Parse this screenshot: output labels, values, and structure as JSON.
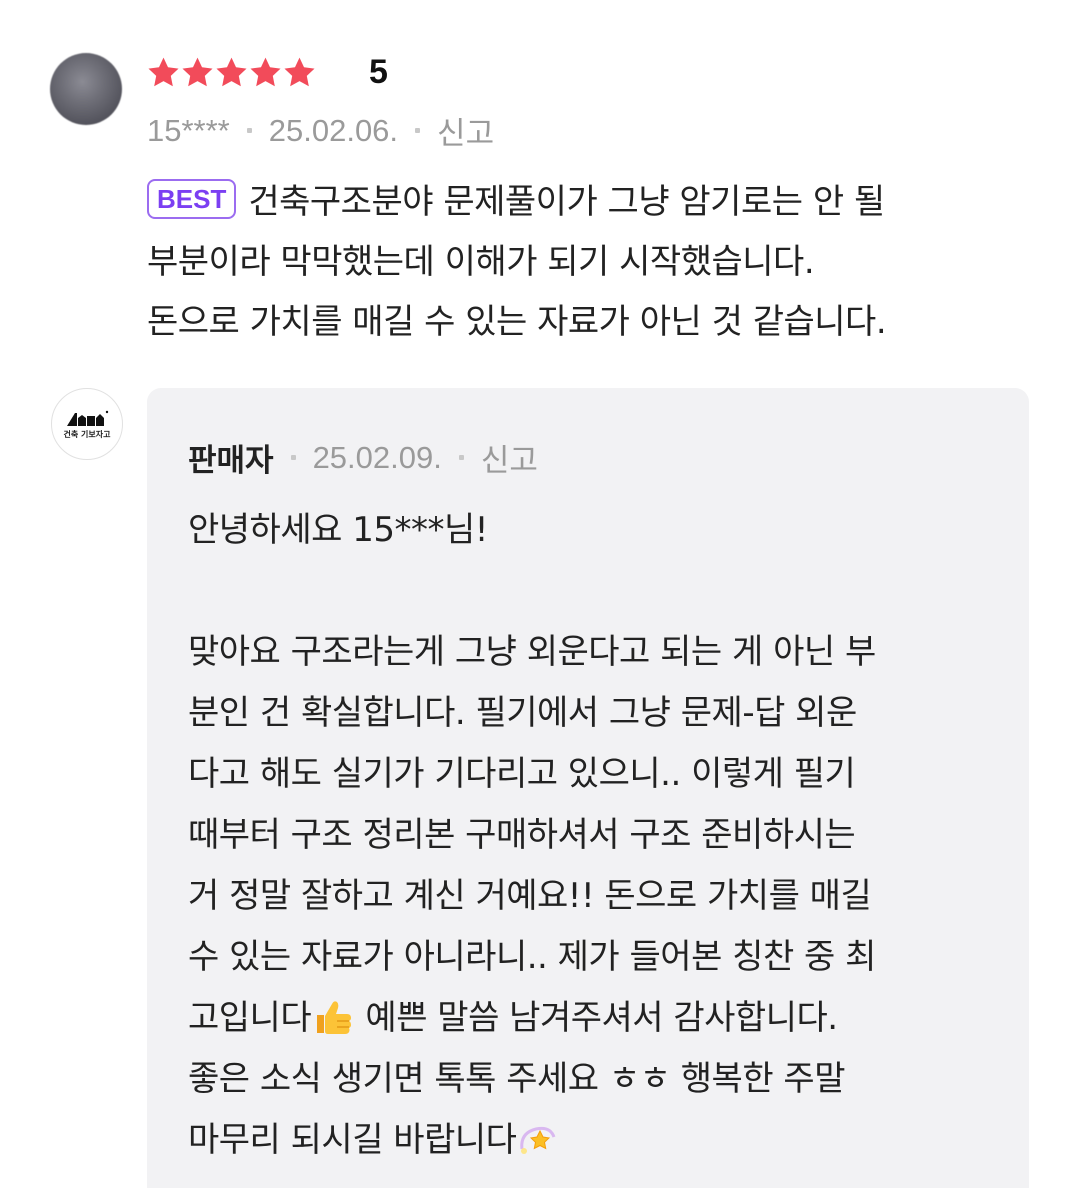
{
  "review": {
    "rating": "5",
    "stars_count": 5,
    "star_color": "#f24b5a",
    "user": "15****",
    "date": "25.02.06.",
    "report_label": "신고",
    "badge": "BEST",
    "badge_color": "#7b3ff2",
    "text_lines": [
      "건축구조분야 문제풀이가 그냥 암기로는 안 될",
      "부분이라 막막했는데 이해가 되기 시작했습니다.",
      "돈으로 가치를 매길 수 있는 자료가 아닌 것 같습니다."
    ]
  },
  "reply": {
    "seller_label": "판매자",
    "date": "25.02.09.",
    "report_label": "신고",
    "logo_text": "건축 기보자고",
    "greeting": "안녕하세요 15***님!",
    "lines": [
      "맞아요 구조라는게 그냥 외운다고 되는 게 아닌 부",
      "분인 건 확실합니다. 필기에서 그냥 문제-답 외운",
      "다고 해도 실기가 기다리고 있으니.. 이렇게 필기",
      "때부터 구조 정리본 구매하셔서 구조 준비하시는",
      "거 정말 잘하고 계신 거예요!! 돈으로 가치를 매길",
      "수 있는 자료가 아니라니.. 제가 들어본 칭찬 중 최"
    ],
    "line7_a": "고입니다",
    "line7_b": " 예쁜 말씀 남겨주셔서 감사합니다.",
    "line8": "좋은 소식 생기면 톡톡 주세요 ㅎㅎ 행복한 주말",
    "line9": "마무리 되시길 바랍니다",
    "emoji_thumbs": "thumbs-up-icon",
    "emoji_dizzy": "dizzy-star-icon"
  }
}
